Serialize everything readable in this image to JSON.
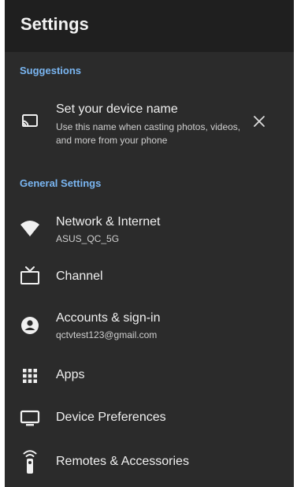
{
  "header": {
    "title": "Settings"
  },
  "suggestions": {
    "label": "Suggestions",
    "items": [
      {
        "title": "Set your device name",
        "subtitle_line1": "Use this name when casting photos, videos,",
        "subtitle_line2": "and more from your phone",
        "icon": "cast-icon",
        "dismiss_icon": "close-icon"
      }
    ]
  },
  "general": {
    "label": "General Settings",
    "items": [
      {
        "title": "Network & Internet",
        "subtitle": "ASUS_QC_5G",
        "icon": "wifi-icon"
      },
      {
        "title": "Channel",
        "icon": "tv-icon"
      },
      {
        "title": "Accounts & sign-in",
        "subtitle": "qctvtest123@gmail.com",
        "icon": "account-icon"
      },
      {
        "title": "Apps",
        "icon": "apps-grid-icon"
      },
      {
        "title": "Device Preferences",
        "icon": "monitor-icon"
      },
      {
        "title": "Remotes & Accessories",
        "icon": "remote-icon"
      }
    ]
  },
  "colors": {
    "background": "#2b2b2b",
    "header": "#1f1f1f",
    "section_accent": "#7ab6f2",
    "text_primary": "#f0f0f0",
    "text_secondary": "#cfcfcf"
  }
}
